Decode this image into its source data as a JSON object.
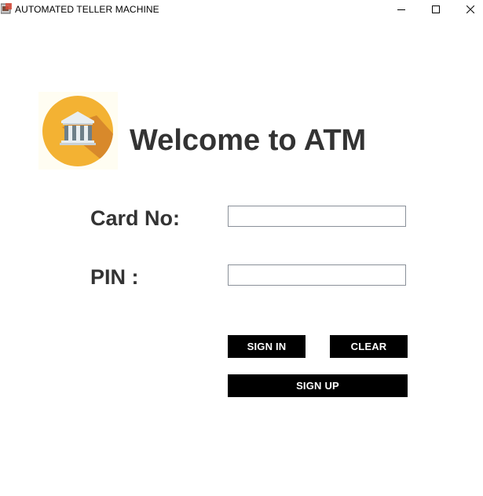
{
  "window": {
    "title": "AUTOMATED TELLER MACHINE",
    "icon": "app-window-icon",
    "controls": [
      "minimize-icon",
      "maximize-icon",
      "close-icon"
    ]
  },
  "header": {
    "logo_icon": "bank-building-icon",
    "welcome_text": "Welcome to ATM"
  },
  "form": {
    "card_label": "Card No:",
    "card_value": "",
    "pin_label": "PIN :",
    "pin_value": ""
  },
  "buttons": {
    "sign_in": "SIGN IN",
    "clear": "CLEAR",
    "sign_up": "SIGN UP"
  },
  "colors": {
    "logo_circle": "#F3B233",
    "logo_shadow": "#D8892B",
    "building": "#E9EEF1",
    "columns": "#6E7F88",
    "text": "#333333",
    "button_bg": "#000000",
    "button_text": "#FFFFFF"
  }
}
